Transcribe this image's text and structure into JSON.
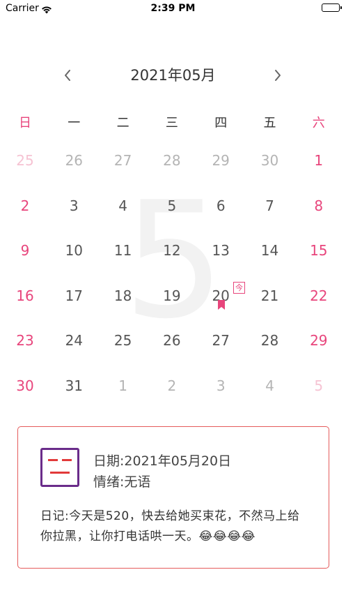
{
  "status_bar": {
    "carrier": "Carrier",
    "time": "2:39 PM"
  },
  "header": {
    "title": "2021年05月",
    "prev_icon": "chevron-left-icon",
    "next_icon": "chevron-right-icon"
  },
  "weekdays": [
    "日",
    "一",
    "二",
    "三",
    "四",
    "五",
    "六"
  ],
  "background_month": "5",
  "calendar": {
    "rows": [
      [
        {
          "d": "25",
          "other": true
        },
        {
          "d": "26",
          "other": true
        },
        {
          "d": "27",
          "other": true
        },
        {
          "d": "28",
          "other": true
        },
        {
          "d": "29",
          "other": true
        },
        {
          "d": "30",
          "other": true
        },
        {
          "d": "1",
          "other": false
        }
      ],
      [
        {
          "d": "2",
          "other": false
        },
        {
          "d": "3",
          "other": false
        },
        {
          "d": "4",
          "other": false
        },
        {
          "d": "5",
          "other": false
        },
        {
          "d": "6",
          "other": false
        },
        {
          "d": "7",
          "other": false
        },
        {
          "d": "8",
          "other": false
        }
      ],
      [
        {
          "d": "9",
          "other": false
        },
        {
          "d": "10",
          "other": false
        },
        {
          "d": "11",
          "other": false
        },
        {
          "d": "12",
          "other": false
        },
        {
          "d": "13",
          "other": false
        },
        {
          "d": "14",
          "other": false
        },
        {
          "d": "15",
          "other": false
        }
      ],
      [
        {
          "d": "16",
          "other": false
        },
        {
          "d": "17",
          "other": false
        },
        {
          "d": "18",
          "other": false
        },
        {
          "d": "19",
          "other": false
        },
        {
          "d": "20",
          "other": false
        },
        {
          "d": "21",
          "other": false
        },
        {
          "d": "22",
          "other": false
        }
      ],
      [
        {
          "d": "23",
          "other": false
        },
        {
          "d": "24",
          "other": false
        },
        {
          "d": "25",
          "other": false
        },
        {
          "d": "26",
          "other": false
        },
        {
          "d": "27",
          "other": false
        },
        {
          "d": "28",
          "other": false
        },
        {
          "d": "29",
          "other": false
        }
      ],
      [
        {
          "d": "30",
          "other": false
        },
        {
          "d": "31",
          "other": false
        },
        {
          "d": "1",
          "other": true
        },
        {
          "d": "2",
          "other": true
        },
        {
          "d": "3",
          "other": true
        },
        {
          "d": "4",
          "other": true
        },
        {
          "d": "5",
          "other": true
        }
      ]
    ]
  },
  "today_badge": "今",
  "colors": {
    "accent": "#e8457c",
    "card_border": "#e55b5b",
    "mood_frame": "#6a2c8a"
  },
  "diary": {
    "date": "日期:2021年05月20日",
    "mood": "情绪:无语",
    "text": "日记:今天是520，快去给她买束花，不然马上给你拉黑，让你打电话哄一天。😂😂😂😂",
    "mood_icon": "speechless-face-icon"
  }
}
